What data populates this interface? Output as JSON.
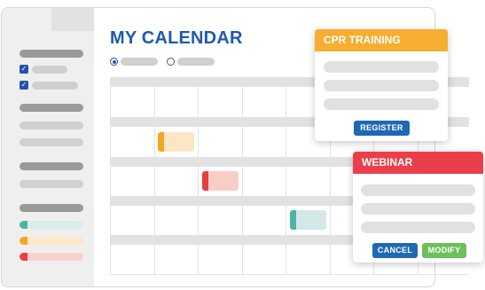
{
  "calendar": {
    "title": "MY CALENDAR"
  },
  "sidebar": {
    "filters": [
      {
        "checked": true
      },
      {
        "checked": true
      }
    ],
    "legend": [
      {
        "color": "#4fb3a4",
        "fill": "#d9edeb"
      },
      {
        "color": "#f5a623",
        "fill": "#fde7c8"
      },
      {
        "color": "#e84040",
        "fill": "#f9d1cc"
      }
    ]
  },
  "view_options": [
    {
      "selected": true
    },
    {
      "selected": false
    }
  ],
  "events": [
    {
      "color": "#f5a623",
      "fill": "#fde5c5"
    },
    {
      "color": "#e84040",
      "fill": "#f9cdc7"
    },
    {
      "color": "#4fb3a4",
      "fill": "#d3e8e7"
    }
  ],
  "popups": {
    "cpr_training": {
      "title": "CPR TRAINING",
      "color": "#f7ad30",
      "register_label": "REGISTER",
      "register_color": "#1f69b4"
    },
    "webinar": {
      "title": "WEBINAR",
      "color": "#ea3f4b",
      "cancel_label": "CANCEL",
      "cancel_color": "#1f69b4",
      "modify_label": "MODIFY",
      "modify_color": "#6cbf5a"
    }
  },
  "icons": {
    "checkbox": "checkmark-icon",
    "radio": "radio-icon"
  }
}
